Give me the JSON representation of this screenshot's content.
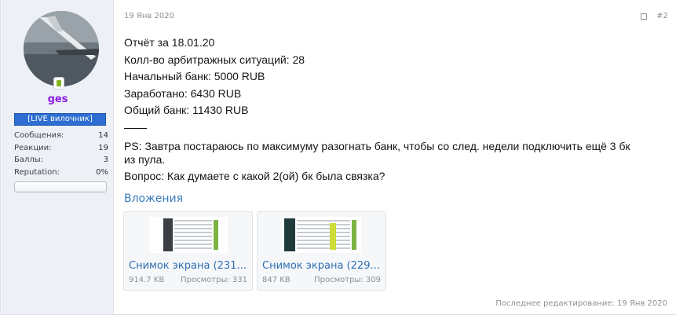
{
  "user": {
    "name": "ges",
    "title": "[LIVE вилочник]",
    "stats": [
      {
        "key": "Сообщения:",
        "value": "14"
      },
      {
        "key": "Реакции:",
        "value": "19"
      },
      {
        "key": "Баллы:",
        "value": "3"
      },
      {
        "key": "Reputation:",
        "value": "0%"
      }
    ]
  },
  "post": {
    "date": "19 Янв 2020",
    "number": "#2",
    "lines": [
      "Отчёт за 18.01.20",
      "Колл-во арбитражных ситуаций: 28",
      "Начальный банк: 5000 RUB",
      "Заработано: 6430 RUB",
      "Общий банк: 11430 RUB"
    ],
    "ps_line1": "PS: Завтра постараюсь по максимуму разогнать банк, чтобы со след. недели подключить ещё 3 бк",
    "ps_line2": "из пула.",
    "question": "Вопрос: Как думаете с какой 2(ой) бк была связка?",
    "last_edited": "Последнее редактирование: 19 Янв 2020"
  },
  "attachments": {
    "title": "Вложения",
    "items": [
      {
        "name": "Снимок экрана (231...",
        "size": "914.7 KB",
        "views": "Просмотры: 331"
      },
      {
        "name": "Снимок экрана (229...",
        "size": "847 KB",
        "views": "Просмотры: 309"
      }
    ]
  },
  "colors": {
    "username": "#8a1ce8",
    "title_badge": "#2e6ed2",
    "link": "#2f6fb3",
    "online": "#84b51d"
  }
}
